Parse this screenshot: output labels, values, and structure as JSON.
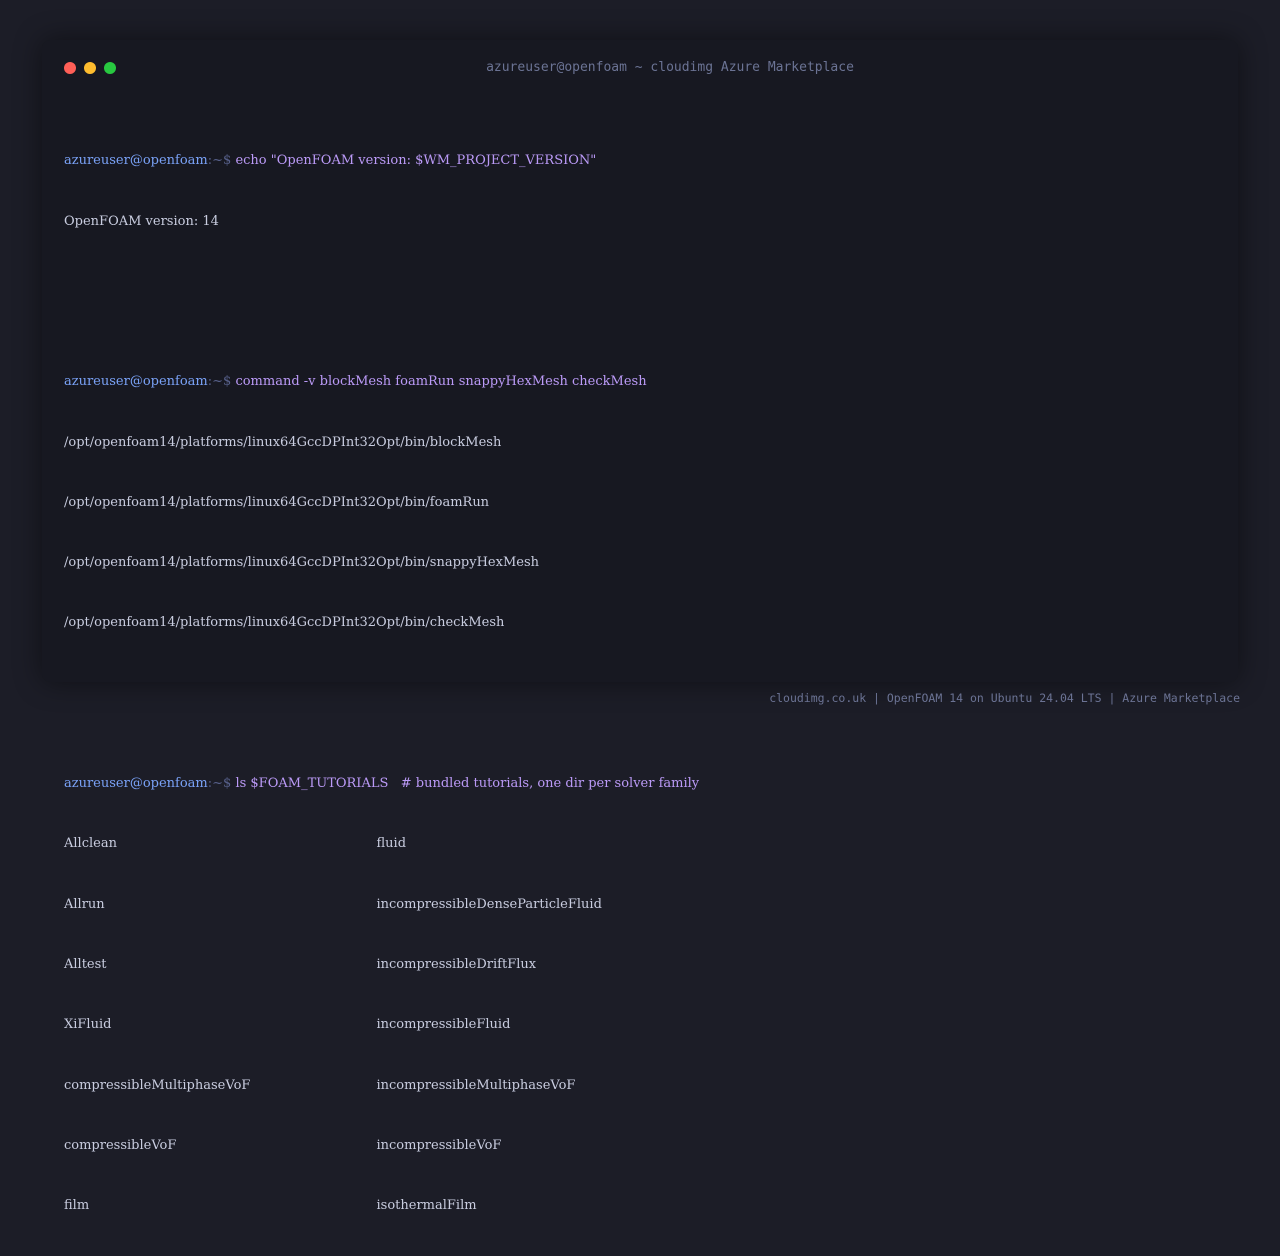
{
  "window": {
    "title": "azureuser@openfoam ~ cloudimg Azure Marketplace",
    "traffic_lights": {
      "close_color": "#ff5f57",
      "minimize_color": "#febc2e",
      "maximize_color": "#28c840"
    }
  },
  "colors": {
    "background": "#1c1d27",
    "terminal_background": "#171821",
    "prompt_user": "#7aa2f7",
    "prompt_path": "#565f89",
    "command": "#bb9af7",
    "output": "#c9cde0"
  },
  "prompt": {
    "user_host": "azureuser@openfoam",
    "path_symbol": ":~$ "
  },
  "blocks": [
    {
      "command": "echo \"OpenFOAM version: $WM_PROJECT_VERSION\"",
      "output": [
        "OpenFOAM version: 14"
      ]
    },
    {
      "command": "command -v blockMesh foamRun snappyHexMesh checkMesh",
      "output": [
        "/opt/openfoam14/platforms/linux64GccDPInt32Opt/bin/blockMesh",
        "/opt/openfoam14/platforms/linux64GccDPInt32Opt/bin/foamRun",
        "/opt/openfoam14/platforms/linux64GccDPInt32Opt/bin/snappyHexMesh",
        "/opt/openfoam14/platforms/linux64GccDPInt32Opt/bin/checkMesh"
      ]
    },
    {
      "command": "ls $FOAM_TUTORIALS   # bundled tutorials, one dir per solver family",
      "listing": [
        [
          "Allclean",
          "fluid"
        ],
        [
          "Allrun",
          "incompressibleDenseParticleFluid"
        ],
        [
          "Alltest",
          "incompressibleDriftFlux"
        ],
        [
          "XiFluid",
          "incompressibleFluid"
        ],
        [
          "compressibleMultiphaseVoF",
          "incompressibleMultiphaseVoF"
        ],
        [
          "compressibleVoF",
          "incompressibleVoF"
        ],
        [
          "film",
          "isothermalFilm"
        ]
      ]
    }
  ],
  "footer": "cloudimg.co.uk | OpenFOAM 14 on Ubuntu 24.04 LTS | Azure Marketplace"
}
